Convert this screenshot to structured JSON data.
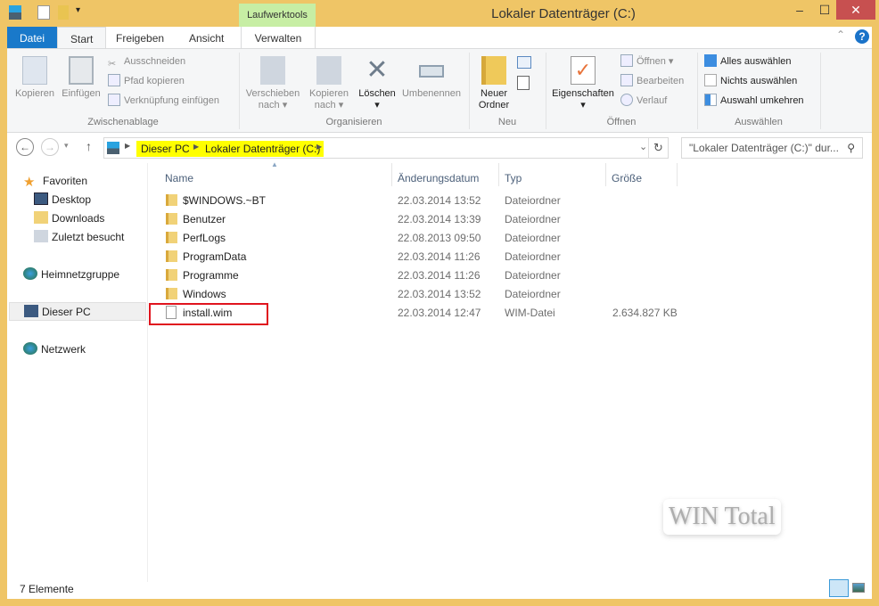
{
  "window": {
    "title": "Lokaler Datenträger (C:)",
    "minimize": "–",
    "maximize": "☐",
    "close": "✕"
  },
  "tabs": {
    "file": "Datei",
    "start": "Start",
    "share": "Freigeben",
    "view": "Ansicht",
    "context_group": "Laufwerktools",
    "manage": "Verwalten"
  },
  "ribbon": {
    "clipboard": {
      "label": "Zwischenablage",
      "copy": "Kopieren",
      "paste": "Einfügen",
      "cut": "Ausschneiden",
      "copy_path": "Pfad kopieren",
      "paste_shortcut": "Verknüpfung einfügen"
    },
    "organize": {
      "label": "Organisieren",
      "move_to": "Verschieben",
      "move_to2": "nach",
      "copy_to": "Kopieren",
      "copy_to2": "nach",
      "delete": "Löschen",
      "rename": "Umbenennen"
    },
    "new": {
      "label": "Neu",
      "new_folder": "Neuer",
      "new_folder2": "Ordner"
    },
    "open": {
      "label": "Öffnen",
      "properties": "Eigenschaften",
      "open": "Öffnen",
      "edit": "Bearbeiten",
      "history": "Verlauf"
    },
    "select": {
      "label": "Auswählen",
      "all": "Alles auswählen",
      "none": "Nichts auswählen",
      "invert": "Auswahl umkehren"
    }
  },
  "address": {
    "crumbs": [
      "Dieser PC",
      "Lokaler Datenträger (C:)"
    ],
    "search_placeholder": "\"Lokaler Datenträger (C:)\" dur..."
  },
  "nav": {
    "favorites": "Favoriten",
    "desktop": "Desktop",
    "downloads": "Downloads",
    "recent": "Zuletzt besucht",
    "homegroup": "Heimnetzgruppe",
    "this_pc": "Dieser PC",
    "network": "Netzwerk"
  },
  "columns": {
    "name": "Name",
    "date": "Änderungsdatum",
    "type": "Typ",
    "size": "Größe"
  },
  "files": [
    {
      "name": "$WINDOWS.~BT",
      "date": "22.03.2014 13:52",
      "type": "Dateiordner",
      "size": ""
    },
    {
      "name": "Benutzer",
      "date": "22.03.2014 13:39",
      "type": "Dateiordner",
      "size": ""
    },
    {
      "name": "PerfLogs",
      "date": "22.08.2013 09:50",
      "type": "Dateiordner",
      "size": ""
    },
    {
      "name": "ProgramData",
      "date": "22.03.2014 11:26",
      "type": "Dateiordner",
      "size": ""
    },
    {
      "name": "Programme",
      "date": "22.03.2014 11:26",
      "type": "Dateiordner",
      "size": ""
    },
    {
      "name": "Windows",
      "date": "22.03.2014 13:52",
      "type": "Dateiordner",
      "size": ""
    },
    {
      "name": "install.wim",
      "date": "22.03.2014 12:47",
      "type": "WIM-Datei",
      "size": "2.634.827 KB"
    }
  ],
  "status": {
    "count": "7 Elemente"
  },
  "watermark": "WIN Total"
}
